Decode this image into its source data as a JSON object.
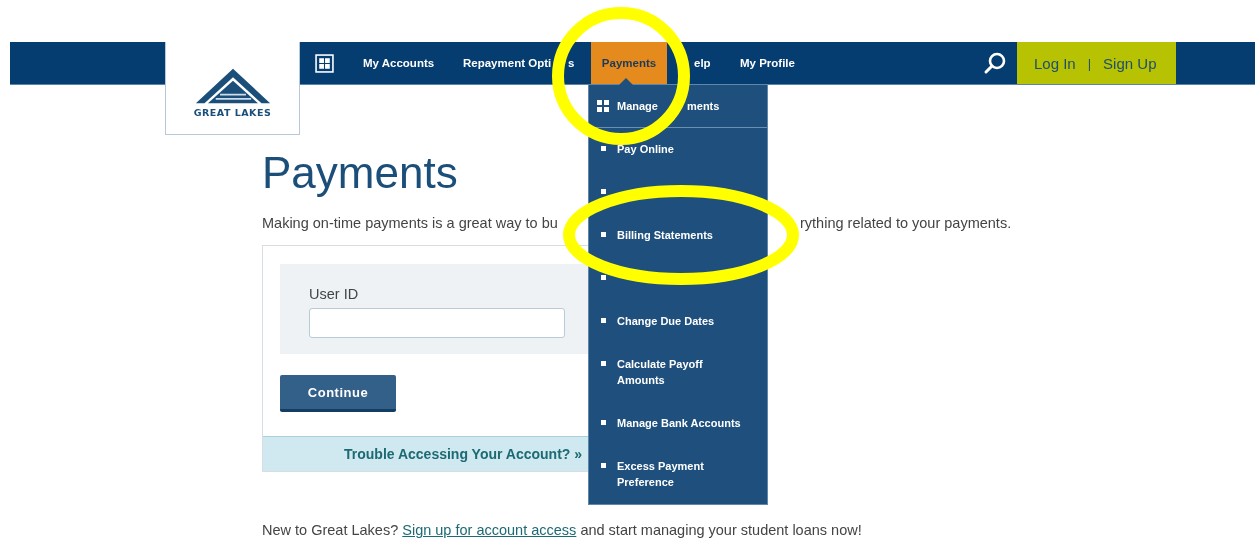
{
  "logo": {
    "text": "GREAT LAKES"
  },
  "nav": {
    "items": [
      {
        "label": "My Accounts",
        "selected": false
      },
      {
        "label": "Repayment Opti",
        "tail": "s",
        "selected": false
      },
      {
        "label": "Payments",
        "selected": true
      },
      {
        "label": "elp",
        "selected": false
      },
      {
        "label": "My Profile",
        "selected": false
      }
    ],
    "login": "Log In",
    "separator": "|",
    "signup": "Sign Up"
  },
  "dropdown": {
    "header": "Manage",
    "header_tail": "ments",
    "items": [
      {
        "kind": "link",
        "label": "Pay Online"
      },
      {
        "kind": "covered"
      },
      {
        "kind": "link",
        "label": "Billing Statements"
      },
      {
        "kind": "covered"
      },
      {
        "kind": "link",
        "label": "Change Due Dates"
      },
      {
        "kind": "link",
        "label": "Calculate Payoff Amounts"
      },
      {
        "kind": "link",
        "label": "Manage Bank Accounts"
      },
      {
        "kind": "link",
        "label": "Excess Payment Preference"
      }
    ]
  },
  "page": {
    "title": "Payments",
    "intro_left": "Making on-time payments is a great way to bu",
    "intro_right": "rything related to your payments."
  },
  "login_form": {
    "user_id_label": "User ID",
    "continue": "Continue",
    "trouble": "Trouble Accessing Your Account? »"
  },
  "footer_note": {
    "before": "New to Great Lakes?",
    "link": "Sign up for account access",
    "after": "and start managing your student loans now!"
  }
}
